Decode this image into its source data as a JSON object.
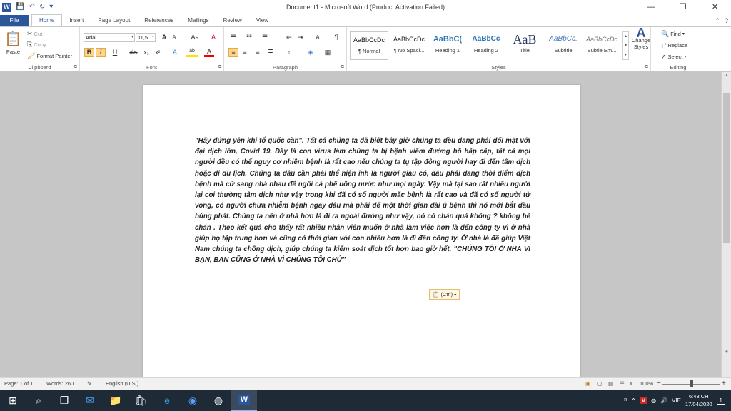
{
  "window": {
    "title": "Document1 - Microsoft Word (Product Activation Failed)",
    "minimize_icon": "—",
    "restore_icon": "❐",
    "close_icon": "✕"
  },
  "quick_access": {
    "app_icon": "W",
    "save": "💾",
    "undo": "↶",
    "redo": "↻",
    "customize": "▾"
  },
  "tabs": [
    "File",
    "Home",
    "Insert",
    "Page Layout",
    "References",
    "Mailings",
    "Review",
    "View"
  ],
  "tab_right": {
    "minimize_ribbon": "⌃",
    "help": "?"
  },
  "ribbon": {
    "clipboard": {
      "label": "Clipboard",
      "paste": "Paste",
      "cut": "Cut",
      "copy": "Copy",
      "format_painter": "Format Painter"
    },
    "font": {
      "label": "Font",
      "font_name": "Arial",
      "font_size": "11,5",
      "grow": "A",
      "shrink": "A",
      "change_case": "Aa",
      "clear": "A",
      "bold": "B",
      "italic": "I",
      "underline": "U",
      "strike": "abc",
      "subscript": "x₂",
      "superscript": "x²",
      "text_effects": "A",
      "highlight": "ab",
      "font_color": "A"
    },
    "paragraph": {
      "label": "Paragraph",
      "pilcrow": "¶",
      "sort": "A↓"
    },
    "styles": {
      "label": "Styles",
      "items": [
        {
          "sample": "AaBbCcDc",
          "name": "¶ Normal"
        },
        {
          "sample": "AaBbCcDc",
          "name": "¶ No Spaci..."
        },
        {
          "sample": "AaBbC(",
          "name": "Heading 1"
        },
        {
          "sample": "AaBbCc",
          "name": "Heading 2"
        },
        {
          "sample": "AaB",
          "name": "Title"
        },
        {
          "sample": "AaBbCc.",
          "name": "Subtitle"
        },
        {
          "sample": "AaBbCcDc",
          "name": "Subtle Em..."
        }
      ],
      "change_styles": "Change Styles"
    },
    "editing": {
      "label": "Editing",
      "find": "Find",
      "replace": "Replace",
      "select": "Select"
    }
  },
  "document": {
    "body": "\"Hãy đứng yên khi tổ quốc cần\". Tất cả chúng ta đã biết bây giờ chúng ta đều đang phải đối mặt với đại dịch lớn, Covid 19. Đây là con virus làm chúng ta bị bệnh viêm đường hô hấp cấp, tất cả mọi người đều có thể nguy cơ nhiễm bệnh là rất cao nếu chúng ta tụ tập đông người hay đi đến tâm dịch hoặc đi du lịch. Chúng ta đâu cần phải thể hiện inh là người giàu có, đâu phải đang thời điểm dịch bệnh mà cứ sang nhà nhau để ngồi cà phê uống nước như mọi ngày. Vậy mà tại sao rất nhiều người lại coi thường tâm dịch như vậy trong khi đã có số người mắc bệnh là rất cao và đã có số người tử vong, có người chưa nhiễm bệnh ngay đâu mà phải để một thời gian dài ủ bệnh thì nó mới bắt đầu bùng phát. Chúng ta nên ở nhà hơn là đi ra ngoài đường như vậy, nó có chán quá không ? không hề chán . Theo kết quả cho thấy rất nhiều nhân viên muốn ở nhà làm việc hơn là đến công ty vì ở nhà giúp họ tập trung hơn và cũng có thời gian với con nhiều hơn là đi đến công ty. Ở nhà là đã giúp Việt Nam chúng ta chống dịch, giúp chúng ta kiểm soát dịch tốt hơn bao giờ hết. \"CHÚNG TÔI Ở NHÀ VÌ BẠN, BẠN CŨNG Ở NHÀ VÌ CHÚNG TÔI CHỨ\"",
    "paste_options": "(Ctrl)"
  },
  "status": {
    "page": "Page: 1 of 1",
    "words": "Words: 260",
    "language": "English (U.S.)",
    "zoom": "100%",
    "zoom_minus": "−",
    "zoom_plus": "+"
  },
  "taskbar": {
    "language": "VIE",
    "time": "6:43 CH",
    "date": "17/04/2020",
    "notification_count": "1"
  },
  "colors": {
    "accent": "#2b579a",
    "taskbar": "#1f2a37",
    "highlight": "#fcd58b"
  }
}
